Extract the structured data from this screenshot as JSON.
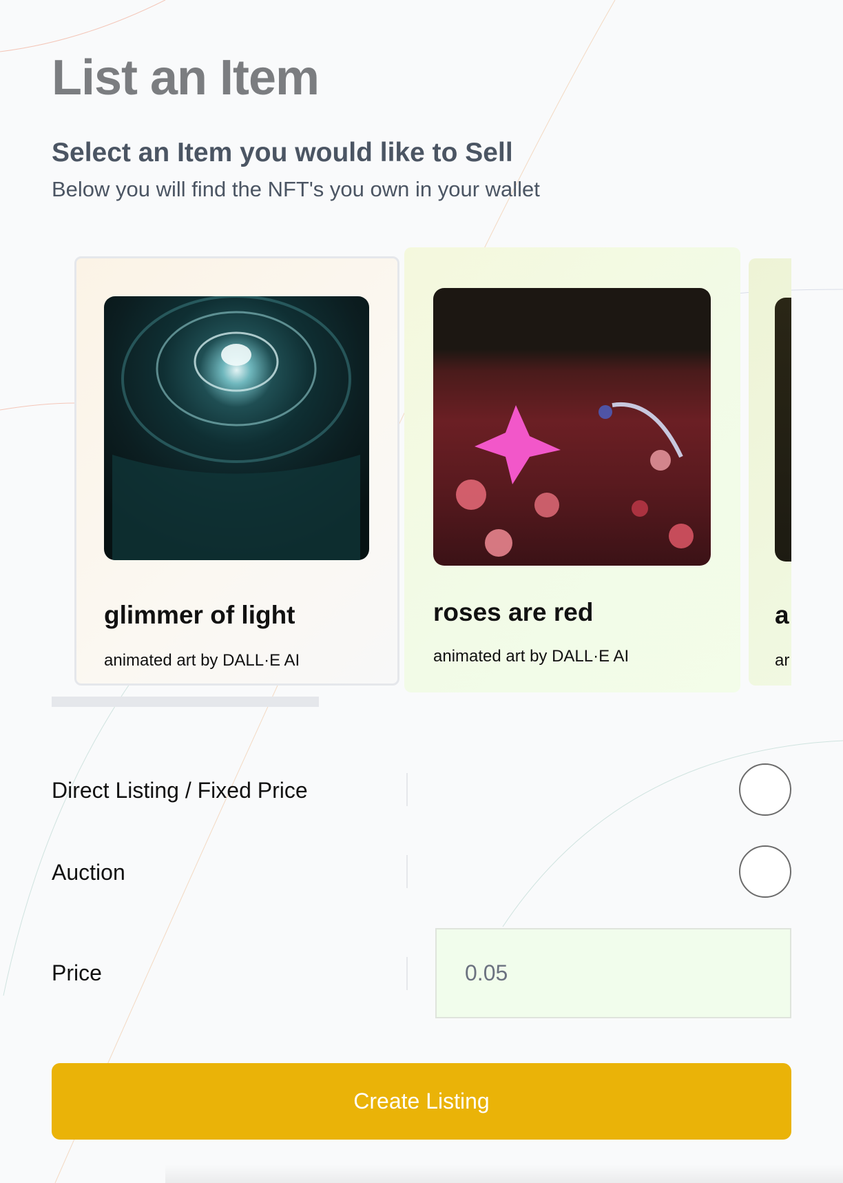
{
  "page": {
    "title": "List an Item",
    "section_heading": "Select an Item you would like to Sell",
    "section_subtitle": "Below you will find the NFT's you own in your wallet"
  },
  "nfts": [
    {
      "name": "glimmer of light",
      "description": "animated art by DALL·E AI"
    },
    {
      "name": "roses are red",
      "description": "animated art by DALL·E AI"
    },
    {
      "name": "a",
      "description": "ar"
    }
  ],
  "form": {
    "direct_listing_label": "Direct Listing / Fixed Price",
    "auction_label": "Auction",
    "price_label": "Price",
    "price_placeholder": "0.05"
  },
  "actions": {
    "create_listing_label": "Create Listing"
  },
  "colors": {
    "page_background": "#f9fafb",
    "title_gray": "#7b7d80",
    "button_yellow": "#eab308",
    "price_field_bg": "#f1fdec"
  }
}
